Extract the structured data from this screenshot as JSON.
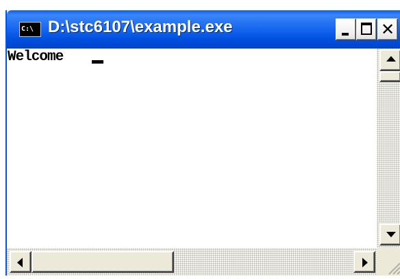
{
  "window": {
    "title": "D:\\stc6107\\example.exe",
    "icon": "C:\\",
    "icon_name": "console-app-icon",
    "buttons": {
      "minimize_icon": "minimize-icon",
      "maximize_icon": "maximize-icon",
      "close_icon": "close-icon",
      "close_glyph": "✕"
    },
    "titlebar_color": "#0054e3"
  },
  "console": {
    "output": "Welcome",
    "background": "#ffffff",
    "text_color": "#000000"
  },
  "scrollbars": {
    "vertical": {
      "up_icon": "arrow-up-icon",
      "down_icon": "arrow-down-icon"
    },
    "horizontal": {
      "left_icon": "arrow-left-icon",
      "right_icon": "arrow-right-icon"
    }
  }
}
